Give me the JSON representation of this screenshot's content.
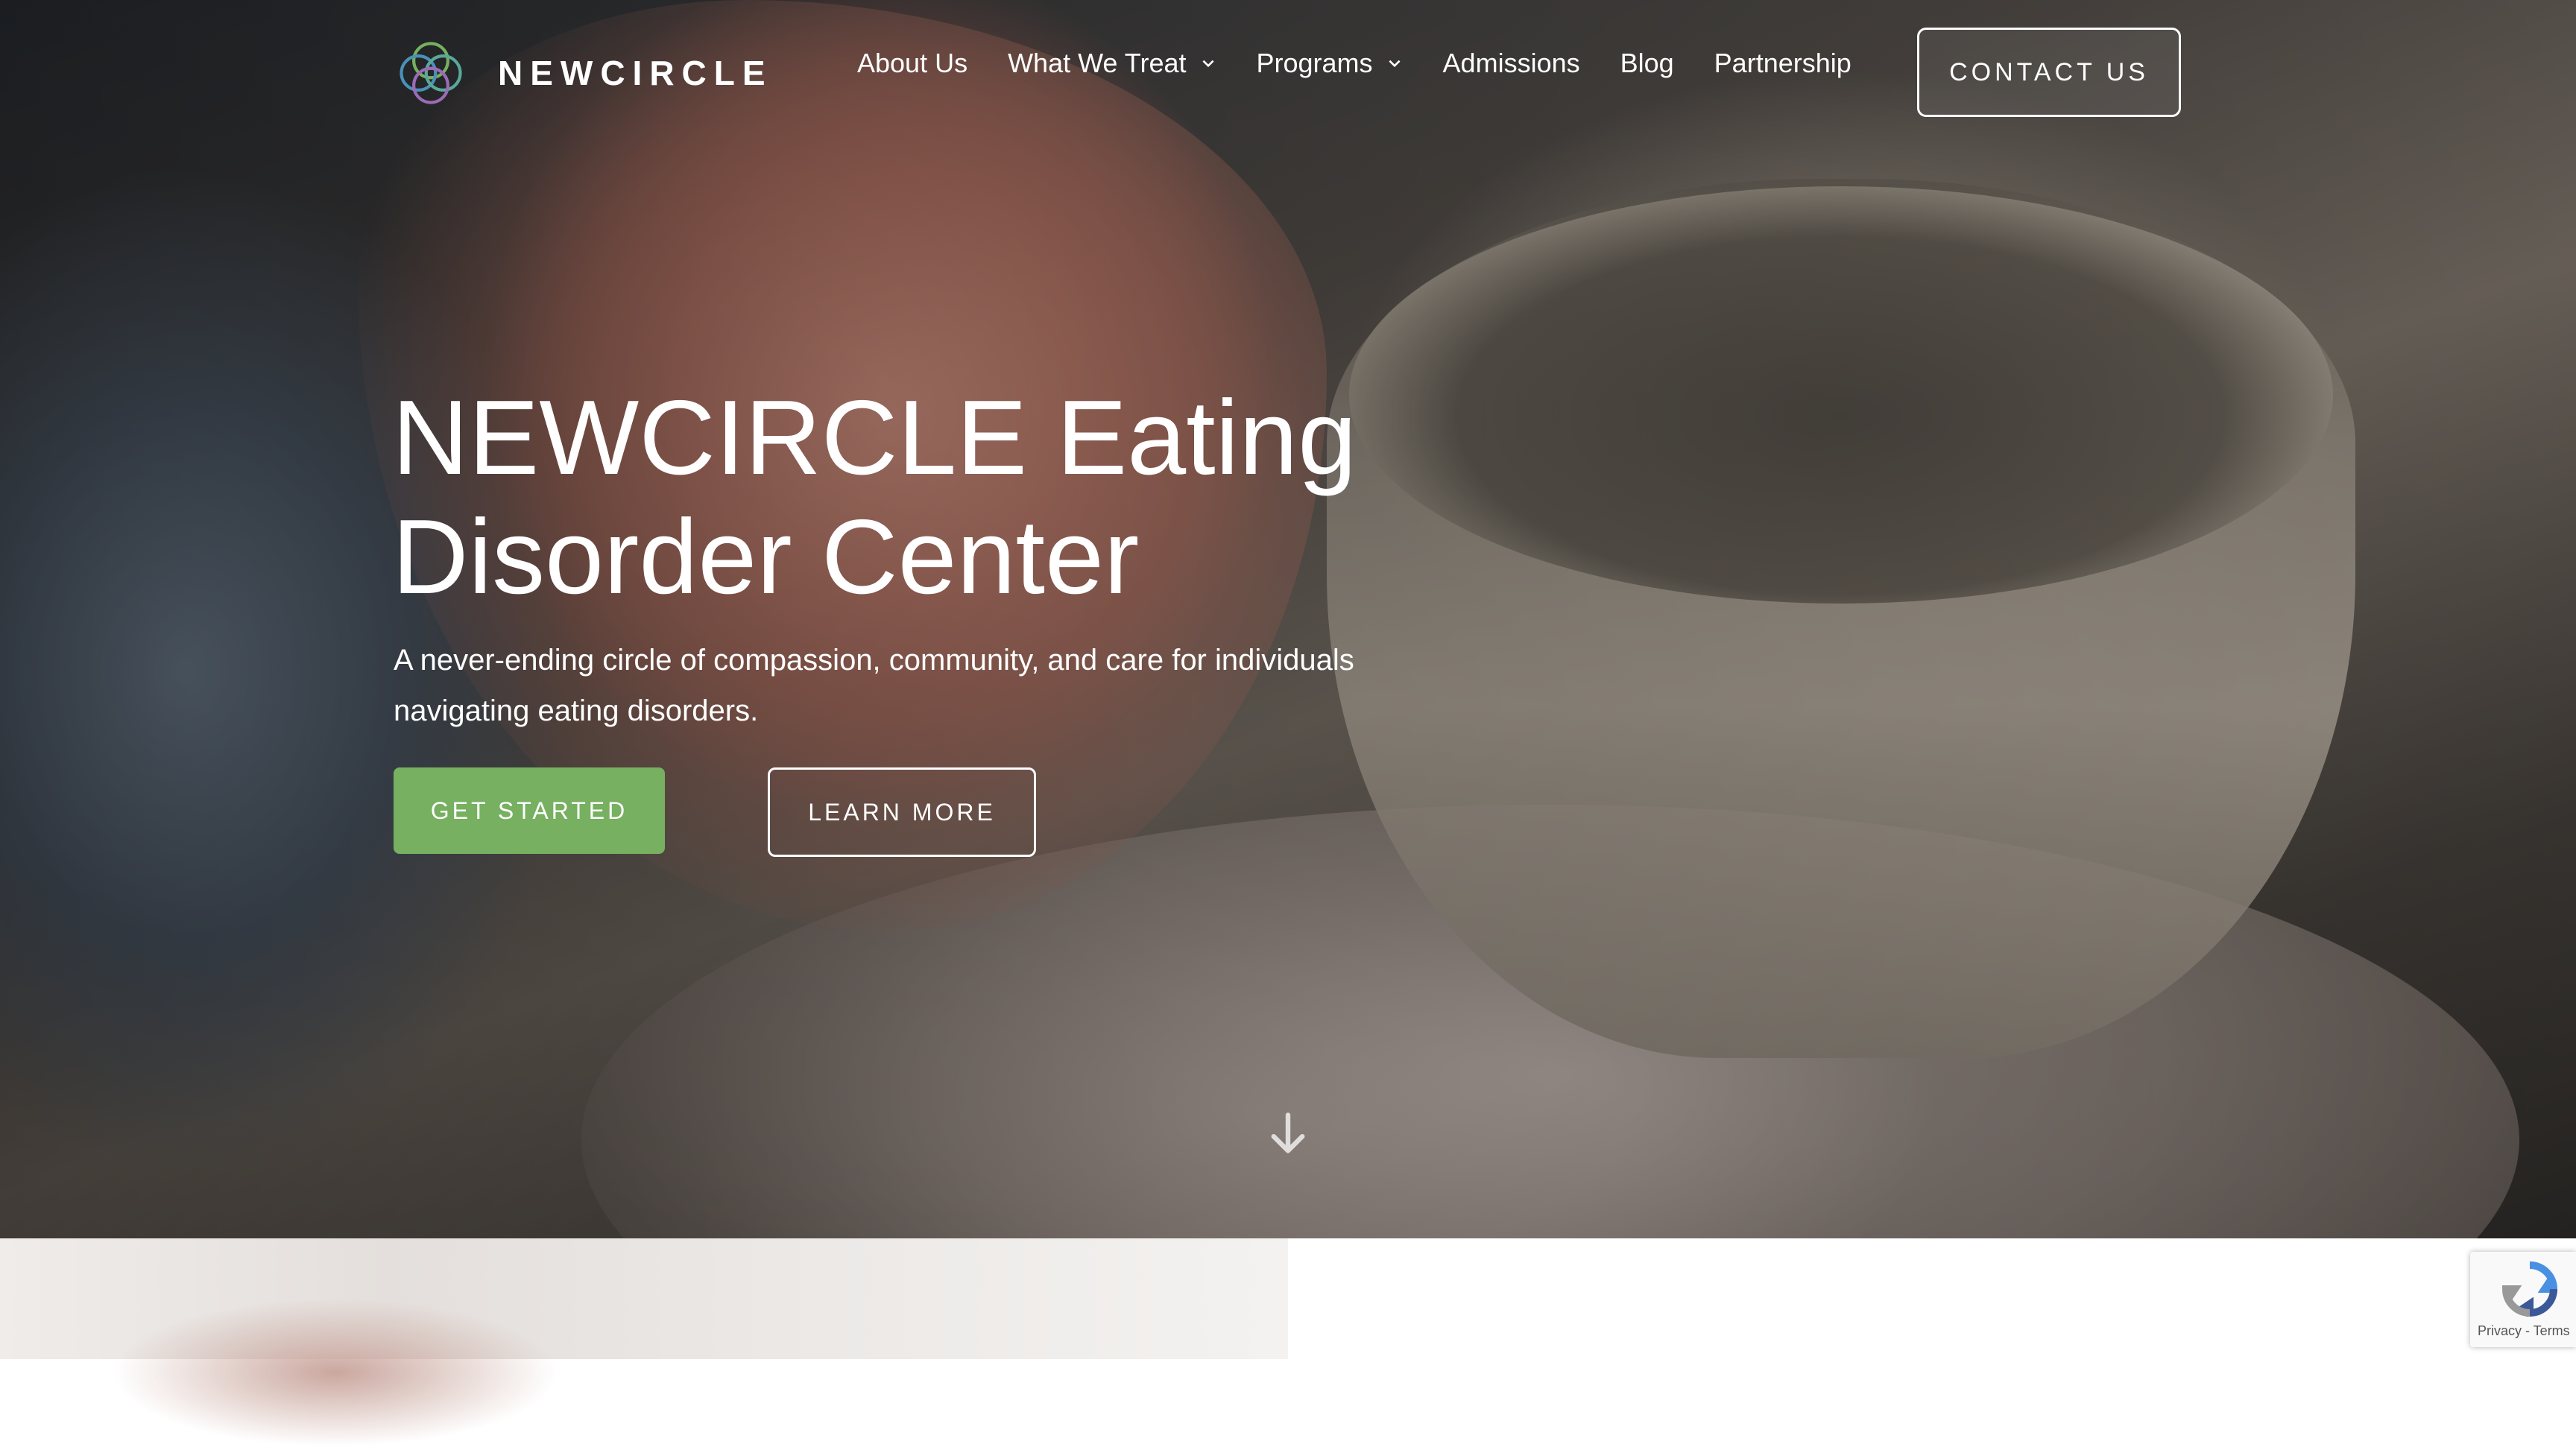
{
  "brand": {
    "name": "NEWCIRCLE",
    "logo_icon": "interlocking-circles-logo",
    "logo_colors": [
      "#76b060",
      "#4a90b8",
      "#9b6bb5"
    ]
  },
  "nav": {
    "items": [
      {
        "label": "About Us",
        "dropdown": false
      },
      {
        "label": "What We Treat",
        "dropdown": true
      },
      {
        "label": "Programs",
        "dropdown": true
      },
      {
        "label": "Admissions",
        "dropdown": false
      },
      {
        "label": "Blog",
        "dropdown": false
      },
      {
        "label": "Partnership",
        "dropdown": false
      }
    ],
    "contact_label": "CONTACT US"
  },
  "hero": {
    "title": "NEWCIRCLE Eating Disorder Center",
    "subtitle": "A never-ending circle of compassion, community, and care for individuals navigating eating disorders.",
    "primary_cta": "GET STARTED",
    "secondary_cta": "LEARN MORE",
    "scroll_icon": "arrow-down-icon"
  },
  "colors": {
    "accent_green": "#76b060",
    "text": "#ffffff"
  },
  "recaptcha": {
    "links": "Privacy - Terms"
  }
}
